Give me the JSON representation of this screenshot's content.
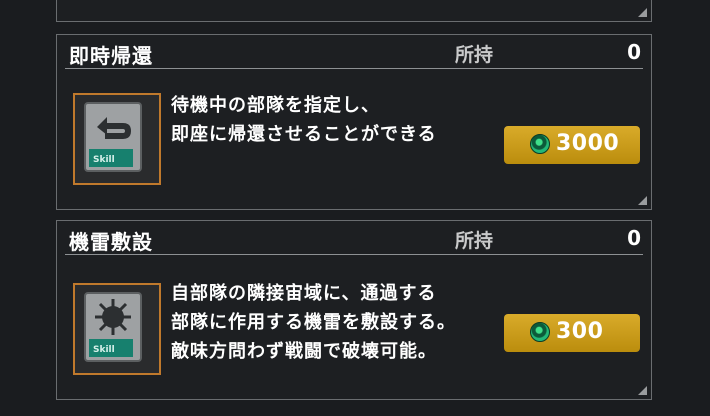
{
  "items": [
    {
      "name": "即時帰還",
      "own_label": "所持",
      "own_count": "0",
      "description_lines": [
        "待機中の部隊を指定し、",
        "即座に帰還させることができる"
      ],
      "price": "3000",
      "price_icon": "credit-coin-icon"
    },
    {
      "name": "機雷敷設",
      "own_label": "所持",
      "own_count": "0",
      "description_lines": [
        "自部隊の隣接宙域に、通過する",
        "部隊に作用する機雷を敷設する。",
        "敵味方問わず戦闘で破壊可能。"
      ],
      "price": "300",
      "price_icon": "credit-coin-icon"
    }
  ],
  "card_label": "Skill",
  "colors": {
    "card_border": "#c0792c",
    "price_button": "#cc9c1a",
    "coin": "#23b877"
  }
}
